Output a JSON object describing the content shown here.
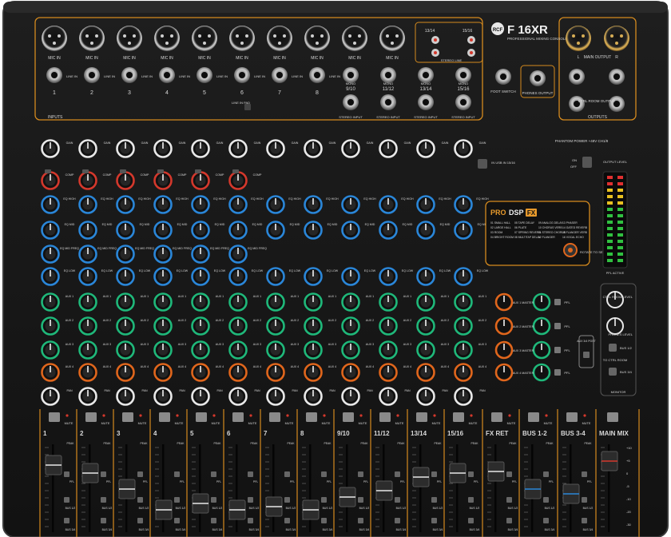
{
  "brand": {
    "logo": "RCF",
    "model": "F 16XR",
    "tagline": "PROFESSIONAL MIXING CONSOLE"
  },
  "colors": {
    "body": "#141414",
    "panel": "#1b1b1b",
    "outline": "#d58a1e",
    "knob_red": "#d4382c",
    "knob_blue": "#2a86d8",
    "knob_green": "#1fb87a",
    "knob_orange": "#e0661c",
    "knob_white": "#e8e8e8",
    "fader_cap": "#2a2a2a",
    "fader_line_blue": "#2a86d8",
    "fader_line_red": "#d4382c"
  },
  "inputs": {
    "section_label": "INPUTS",
    "xlr_label": "MIC IN",
    "line_label": "LINE IN",
    "channels": [
      "1",
      "2",
      "3",
      "4",
      "5",
      "6",
      "7",
      "8"
    ],
    "stereo": [
      "9/10",
      "11/12",
      "13/14",
      "15/16"
    ],
    "stereo_input_label": "STEREO INPUT",
    "mono_label": "MONO",
    "stereo_line_label": "STEREO LINE",
    "rca_labels": [
      "13/14",
      "15/16"
    ],
    "line_in_pad": "LINE IN PAD",
    "on_off": [
      "ON",
      "OFF"
    ],
    "foot_switch": "FOOT SWITCH",
    "phones_output": "PHONES OUTPUT"
  },
  "outputs": {
    "main_output_label": "MAIN OUTPUT",
    "left": "L",
    "right": "R",
    "ctrl_room": "CTRL ROOM OUTPUT",
    "section_label": "OUTPUTS"
  },
  "channel_strip": {
    "gain_label": "GAIN",
    "comp_label": "COMP",
    "eq_high": "EQ HIGH",
    "eq_mid": "EQ MID",
    "eq_mid_freq": "EQ MID FREQ",
    "eq_low": "EQ LOW",
    "aux_labels": [
      "AUX 1",
      "AUX 2",
      "AUX 3",
      "AUX 4"
    ],
    "pan_label": "PAN",
    "bal_label": "BAL",
    "mute_label": "MUTE",
    "peak_label": "PEAK",
    "pfl_label": "PFL",
    "bus_labels": [
      "BUS 1/2",
      "BUS 3/4"
    ]
  },
  "phantom": {
    "label": "PHANTOM POWER +48V CH1/8",
    "on": "ON",
    "off": "OFF"
  },
  "usb": {
    "label": "IN USB IN 15/16"
  },
  "dsp": {
    "title_pro": "PRO",
    "title_dsp": "DSP",
    "title_fx": "FX",
    "presets": [
      [
        "01 SMALL HALL",
        "05 TAPE DELAY",
        "09 ANALOG DELAY",
        "13 PHASER"
      ],
      [
        "02 LARGE HALL",
        "06 PLATE",
        "10 CHORUS VERB",
        "14 GATED REVERB"
      ],
      [
        "03 ROOM",
        "07 SPRING REVERB",
        "11 STEREO CHORUS",
        "15 FLANGER VERB"
      ],
      [
        "04 BRIGHT ROOM",
        "08 MULTITAP DELAY",
        "12 FLANGER",
        "16 VOCAL ECHO"
      ]
    ],
    "rotate_label": "ROTATE TO SEL"
  },
  "meter": {
    "label": "OUTPUT LEVEL",
    "pfl_active": "PFL ACTIVE"
  },
  "aux_master": {
    "labels": [
      "AUX 1 MASTER",
      "AUX 2 MASTER",
      "AUX 3 MASTER",
      "AUX 4 MASTER"
    ],
    "pfl": "PFL",
    "fx_to_aux": [
      "FX TO AUX 1",
      "FX TO AUX 2"
    ]
  },
  "monitor": {
    "ctrl_room_level": "CTRL ROOM LEVEL",
    "phones_level": "PHONES LEVEL",
    "to_ctrl_room": "TO CTRL ROOM",
    "source_main": "MAIN MIX",
    "source_bus12": "BUS 1/2",
    "source_bus34": "BUS 3/4",
    "aux_post": "AUX 3/4 POST",
    "section_label": "MONITOR"
  },
  "faders": {
    "labels": [
      "1",
      "2",
      "3",
      "4",
      "5",
      "6",
      "7",
      "8",
      "9/10",
      "11/12",
      "13/14",
      "15/16",
      "FX RET",
      "BUS 1-2",
      "BUS 3-4",
      "MAIN MIX"
    ],
    "scale": [
      "+10",
      "+5",
      "0",
      "-5",
      "-10",
      "-20",
      "-30"
    ]
  }
}
